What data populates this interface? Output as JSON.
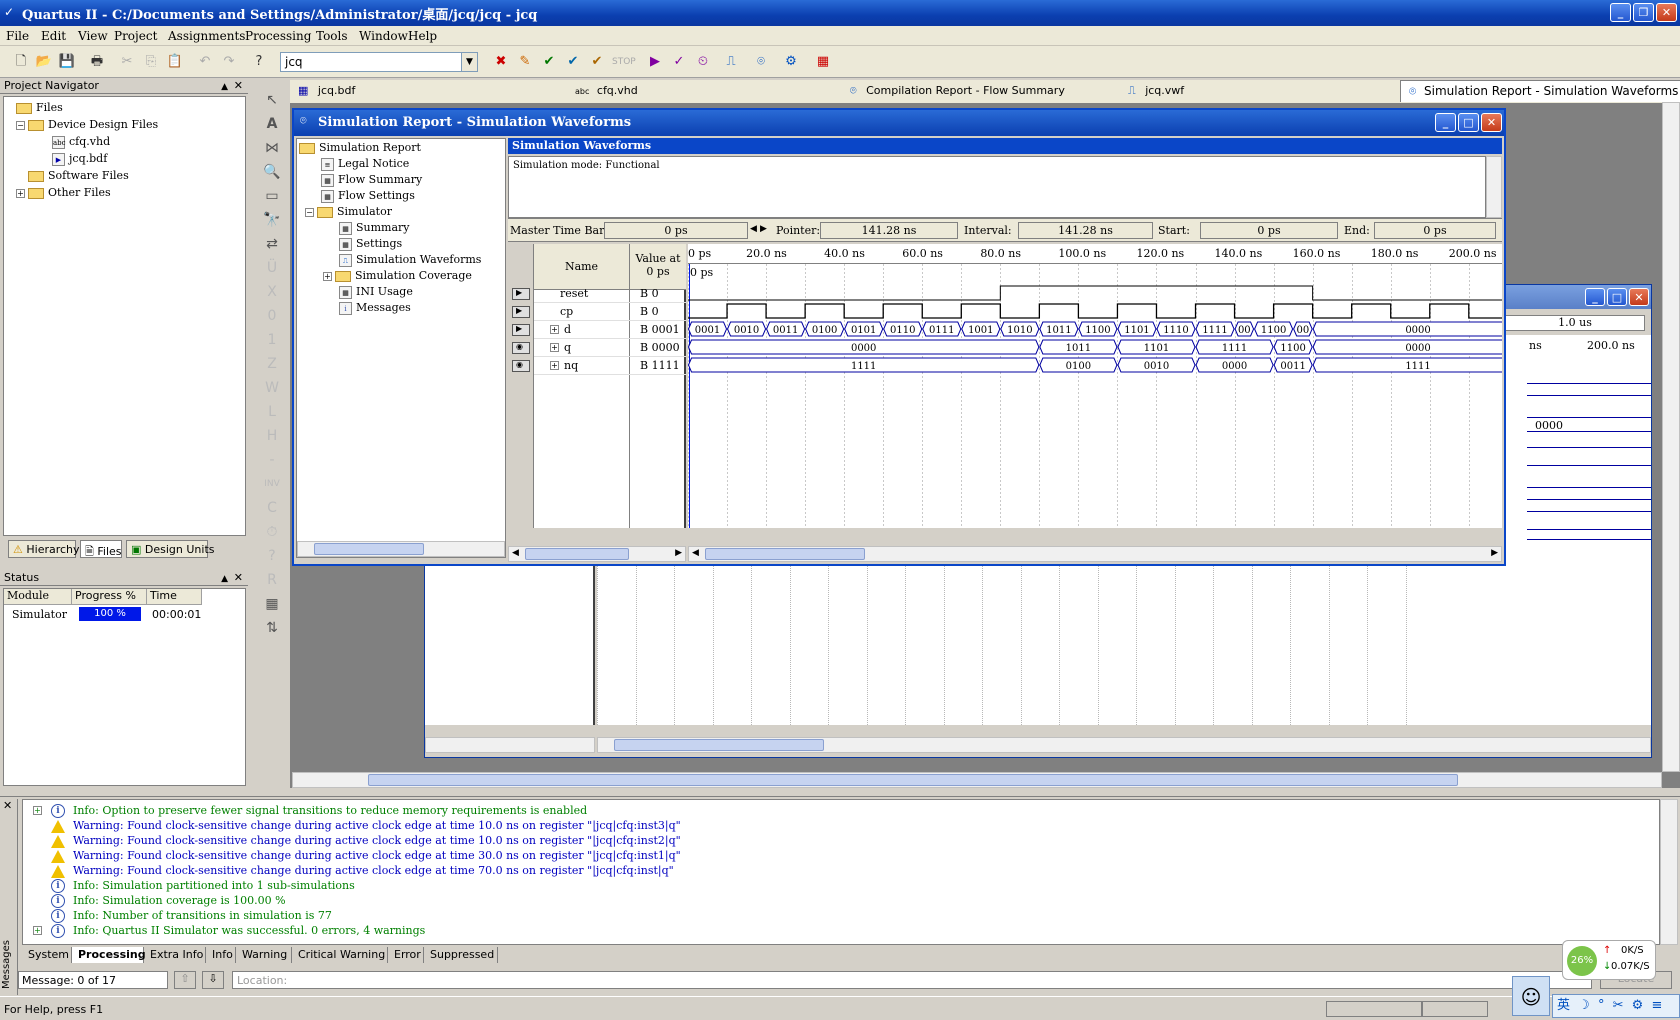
{
  "window": {
    "title": "Quartus II - C:/Documents and Settings/Administrator/桌面/jcq/jcq - jcq"
  },
  "menu": [
    "File",
    "Edit",
    "View",
    "Project",
    "Assignments",
    "Processing",
    "Tools",
    "Window",
    "Help"
  ],
  "toolbar": {
    "combo_value": "jcq"
  },
  "navigator": {
    "title": "Project Navigator",
    "tree": [
      {
        "label": "Files",
        "level": 0,
        "icon": "folder-open"
      },
      {
        "label": "Device Design Files",
        "level": 1,
        "icon": "folder-open"
      },
      {
        "label": "cfq.vhd",
        "level": 2,
        "icon": "vhd-file"
      },
      {
        "label": "jcq.bdf",
        "level": 2,
        "icon": "bdf-file"
      },
      {
        "label": "Software Files",
        "level": 1,
        "icon": "folder"
      },
      {
        "label": "Other Files",
        "level": 1,
        "icon": "folder"
      }
    ],
    "tabs": [
      "Hierarchy",
      "Files",
      "Design Units"
    ]
  },
  "status": {
    "title": "Status",
    "headers": [
      "Module",
      "Progress %",
      "Time"
    ],
    "row": {
      "module": "Simulator",
      "progress": "100 %",
      "time": "00:00:01"
    }
  },
  "doc_tabs": [
    "jcq.bdf",
    "cfq.vhd",
    "Compilation Report - Flow Summary",
    "jcq.vwf",
    "Simulation Report - Simulation Waveforms"
  ],
  "report": {
    "title": "Simulation Report - Simulation Waveforms",
    "tree": [
      {
        "label": "Simulation Report",
        "level": 0
      },
      {
        "label": "Legal Notice",
        "level": 1
      },
      {
        "label": "Flow Summary",
        "level": 1
      },
      {
        "label": "Flow Settings",
        "level": 1
      },
      {
        "label": "Simulator",
        "level": 1
      },
      {
        "label": "Summary",
        "level": 2
      },
      {
        "label": "Settings",
        "level": 2
      },
      {
        "label": "Simulation Waveforms",
        "level": 2
      },
      {
        "label": "Simulation Coverage",
        "level": 2
      },
      {
        "label": "INI Usage",
        "level": 2
      },
      {
        "label": "Messages",
        "level": 2
      }
    ],
    "section_title": "Simulation Waveforms",
    "mode": "Simulation mode: Functional",
    "timebar": {
      "master_label": "Master Time Bar:",
      "master": "0 ps",
      "pointer_label": "Pointer:",
      "pointer": "141.28 ns",
      "interval_label": "Interval:",
      "interval": "141.28 ns",
      "start_label": "Start:",
      "start": "0 ps",
      "end_label": "End:",
      "end": "0 ps"
    },
    "col_name": "Name",
    "col_value": "Value at\n0 ps",
    "time_ticks": [
      "0 ps",
      "20.0 ns",
      "40.0 ns",
      "60.0 ns",
      "80.0 ns",
      "100.0 ns",
      "120.0 ns",
      "140.0 ns",
      "160.0 ns",
      "180.0 ns",
      "200.0 ns"
    ],
    "cursor_label": "0 ps",
    "signals": [
      {
        "name": "reset",
        "value": "B 0",
        "bus": false
      },
      {
        "name": "cp",
        "value": "B 0",
        "bus": false
      },
      {
        "name": "d",
        "value": "B 0001",
        "bus": true
      },
      {
        "name": "q",
        "value": "B 0000",
        "bus": true
      },
      {
        "name": "nq",
        "value": "B 1111",
        "bus": true
      }
    ],
    "reset_wave": [
      [
        0,
        0
      ],
      [
        80,
        1
      ],
      [
        160,
        0
      ]
    ],
    "cp_wave_period_ns": 20,
    "d_segments": [
      [
        0,
        10,
        "0001"
      ],
      [
        10,
        20,
        "0010"
      ],
      [
        20,
        30,
        "0011"
      ],
      [
        30,
        40,
        "0100"
      ],
      [
        40,
        50,
        "0101"
      ],
      [
        50,
        60,
        "0110"
      ],
      [
        60,
        70,
        "0111"
      ],
      [
        70,
        80,
        "1001"
      ],
      [
        80,
        90,
        "1010"
      ],
      [
        90,
        100,
        "1011"
      ],
      [
        100,
        110,
        "1100"
      ],
      [
        110,
        120,
        "1101"
      ],
      [
        120,
        130,
        "1110"
      ],
      [
        130,
        140,
        "1111"
      ],
      [
        140,
        145,
        "00"
      ],
      [
        145,
        155,
        "1100"
      ],
      [
        155,
        160,
        "00"
      ],
      [
        160,
        214,
        "0000"
      ]
    ],
    "q_segments": [
      [
        0,
        90,
        "0000"
      ],
      [
        90,
        110,
        "1011"
      ],
      [
        110,
        130,
        "1101"
      ],
      [
        130,
        150,
        "1111"
      ],
      [
        150,
        160,
        "1100"
      ],
      [
        160,
        214,
        "0000"
      ]
    ],
    "nq_segments": [
      [
        0,
        90,
        "1111"
      ],
      [
        90,
        110,
        "0100"
      ],
      [
        110,
        130,
        "0010"
      ],
      [
        130,
        150,
        "0000"
      ],
      [
        150,
        160,
        "0011"
      ],
      [
        160,
        214,
        "1111"
      ]
    ]
  },
  "back_window": {
    "end_value": "1.0 us",
    "tick_ns": "ns",
    "tick_200": "200.0 ns",
    "value": "0000"
  },
  "messages": {
    "lines": [
      {
        "type": "info",
        "text": "Info: Option to preserve fewer signal transitions to reduce memory requirements is enabled",
        "expand": true
      },
      {
        "type": "warning",
        "text": "Warning: Found clock-sensitive change during active clock edge at time 10.0 ns on register \"|jcq|cfq:inst3|q\""
      },
      {
        "type": "warning",
        "text": "Warning: Found clock-sensitive change during active clock edge at time 10.0 ns on register \"|jcq|cfq:inst2|q\""
      },
      {
        "type": "warning",
        "text": "Warning: Found clock-sensitive change during active clock edge at time 30.0 ns on register \"|jcq|cfq:inst1|q\""
      },
      {
        "type": "warning",
        "text": "Warning: Found clock-sensitive change during active clock edge at time 70.0 ns on register \"|jcq|cfq:inst|q\""
      },
      {
        "type": "info",
        "text": "Info: Simulation partitioned into 1 sub-simulations"
      },
      {
        "type": "info",
        "text": "Info: Simulation coverage is      100.00 %"
      },
      {
        "type": "info",
        "text": "Info: Number of transitions in simulation is 77"
      },
      {
        "type": "info",
        "text": "Info: Quartus II Simulator was successful. 0 errors, 4 warnings",
        "expand": true
      }
    ],
    "tabs": [
      "System",
      "Processing",
      "Extra Info",
      "Info",
      "Warning",
      "Critical Warning",
      "Error",
      "Suppressed"
    ],
    "side_label": "Messages",
    "count": "Message: 0 of 17",
    "location_placeholder": "Location:",
    "locate": "Locate"
  },
  "net": {
    "percent": "26%",
    "up": "0K/S",
    "down": "0.07K/S"
  },
  "statusbar": {
    "help": "For Help, press F1"
  },
  "ime": [
    "英",
    "☽",
    "°",
    "✂",
    "⚙",
    "≡"
  ]
}
